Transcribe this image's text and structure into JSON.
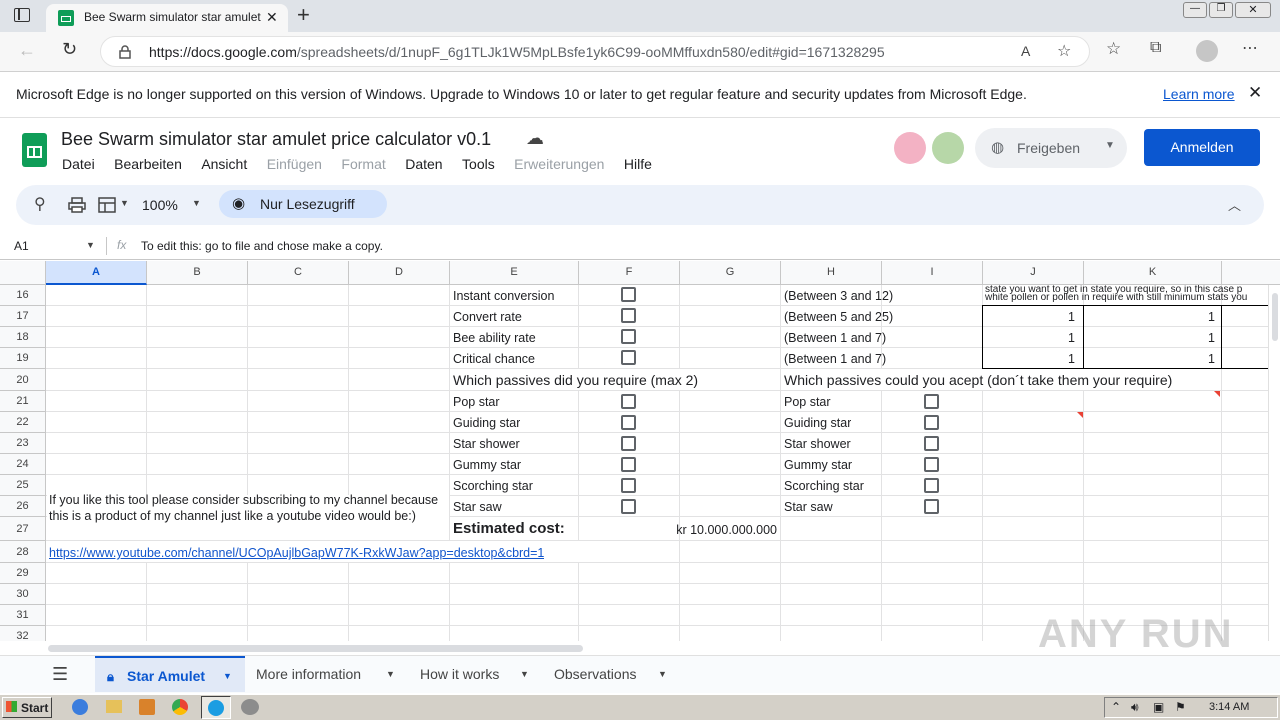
{
  "browser": {
    "tab_title": "Bee Swarm simulator star amulet",
    "url_domain": "https://docs.google.com",
    "url_path": "/spreadsheets/d/1nupF_6g1TLJk1W5MpLBsfe1yk6C99-ooMMffuxdn580/edit#gid=1671328295"
  },
  "infobar": {
    "message": "Microsoft Edge is no longer supported on this version of Windows. Upgrade to Windows 10 or later to get regular feature and security updates from Microsoft Edge.",
    "link": "Learn more"
  },
  "doc": {
    "title": "Bee Swarm simulator star amulet price calculator v0.1",
    "menu": [
      "Datei",
      "Bearbeiten",
      "Ansicht",
      "Einfügen",
      "Format",
      "Daten",
      "Tools",
      "Erweiterungen",
      "Hilfe"
    ],
    "share_label": "Freigeben",
    "signin_label": "Anmelden"
  },
  "toolbar": {
    "zoom": "100%",
    "readonly_label": "Nur Lesezugriff"
  },
  "formula_bar": {
    "cell_ref": "A1",
    "fx": "fx",
    "content": "To edit this: go to file and chose make a copy."
  },
  "grid": {
    "columns": [
      "A",
      "B",
      "C",
      "D",
      "E",
      "F",
      "G",
      "H",
      "I",
      "J",
      "K"
    ],
    "rows": [
      "16",
      "17",
      "18",
      "19",
      "20",
      "21",
      "22",
      "23",
      "24",
      "25",
      "26",
      "27",
      "28",
      "29",
      "30",
      "31",
      "32"
    ],
    "left_stats": [
      "Instant conversion",
      "Convert rate",
      "Bee ability rate",
      "Critical chance"
    ],
    "ranges": [
      "(Between 3 and 12)",
      "(Between 5 and 25)",
      "(Between 1 and 7)",
      "(Between 1 and 7)"
    ],
    "jk_values": [
      "1",
      "1",
      "1"
    ],
    "overflow_text_1": "state you want to get in state you require, so in this case p",
    "overflow_text_2": "white pollen or pollen in require with still minimum stats you",
    "passives_require_heading": "Which passives did you require (max 2)",
    "passives_accept_heading": "Which passives could you acept (don´t take them your require)",
    "passives": [
      "Pop star",
      "Guiding star",
      "Star shower",
      "Gummy star",
      "Scorching star",
      "Star saw"
    ],
    "promo_text": "If you like this tool please consider subscribing to my channel because this is a product of my channel just like a youtube video would be:)",
    "estimated_label": "Estimated cost:",
    "estimated_value": "kr 10.000.000.000",
    "youtube_link": "https://www.youtube.com/channel/UCOpAujlbGapW77K-RxkWJaw?app=desktop&cbrd=1"
  },
  "sheet_tabs": [
    "Star Amulet",
    "More information",
    "How it works",
    "Observations"
  ],
  "taskbar": {
    "start_label": "Start",
    "clock": "3:14 AM"
  },
  "watermark": "ANY RUN",
  "colors": {
    "accent": "#0b57d0",
    "sheets_green": "#0f9d58",
    "selected_header": "#d3e3fd",
    "readonly_pill": "#d3e3fd"
  }
}
